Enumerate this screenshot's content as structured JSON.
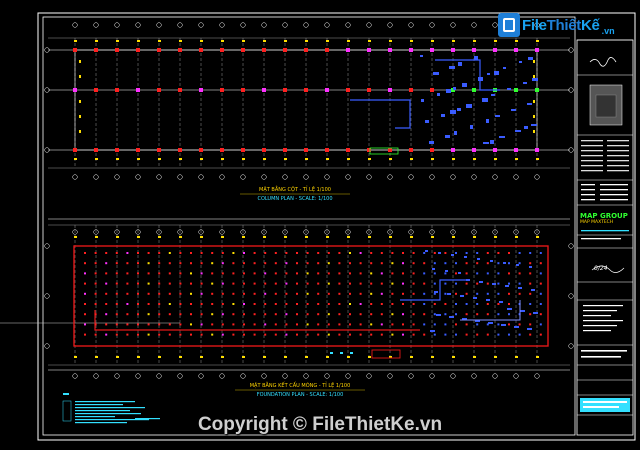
{
  "watermark": {
    "logo_file": "File",
    "logo_thiet": "Thiết",
    "logo_ke": "Kế",
    "logo_tld": ".vn",
    "copyright": "Copyright © FileThietKe.vn"
  },
  "drawing": {
    "column_plan": {
      "title_vn": "MẶT BẰNG CỘT - TỈ LỆ 1/100",
      "title_en": "COLUMN PLAN - SCALE: 1/100"
    },
    "foundation_plan": {
      "title_vn": "MẶT BẰNG KẾT CẤU MÓNG - TỈ LỆ 1/100",
      "title_en": "FOUNDATION PLAN - SCALE: 1/100"
    },
    "title_block": {
      "company": "MAP GROUP",
      "company_sub": "MAP MAXTECH",
      "signature_note": "0/24"
    }
  },
  "colors": {
    "background": "#000000",
    "frame": "#ffffff",
    "grid_line": "#ffffff",
    "column_red": "#ff2020",
    "column_magenta": "#ff30ff",
    "column_green": "#30ff30",
    "dot_yellow": "#ffe000",
    "beam_blue": "#3a5cff",
    "cyan": "#33e0ff",
    "footing_red": "#e01818"
  }
}
